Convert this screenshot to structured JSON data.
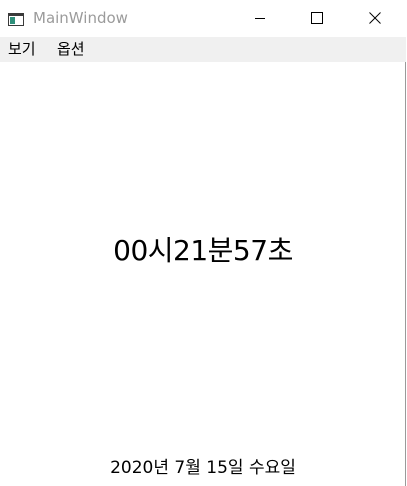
{
  "window": {
    "title": "MainWindow"
  },
  "menu": {
    "items": [
      {
        "label": "보기"
      },
      {
        "label": "옵션"
      }
    ]
  },
  "clock": {
    "time": "00시21분57초",
    "date": "2020년 7월 15일 수요일"
  },
  "icons": {
    "app": "app-window-icon",
    "minimize": "minimize-icon",
    "maximize": "maximize-icon",
    "close": "close-icon"
  }
}
